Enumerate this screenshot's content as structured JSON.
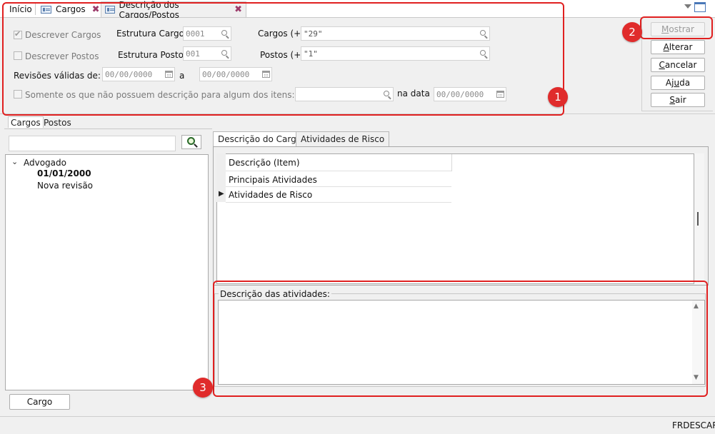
{
  "tabs": [
    {
      "label": "Início",
      "closable": false
    },
    {
      "label": "Cargos",
      "closable": true,
      "icon": "form-icon"
    },
    {
      "label": "Descrição dos Cargos/Postos",
      "closable": true,
      "icon": "form-icon",
      "active": true
    }
  ],
  "filters": {
    "descrever_cargos": {
      "label": "Descrever Cargos",
      "checked": true,
      "enabled": false
    },
    "descrever_postos": {
      "label": "Descrever Postos",
      "checked": false,
      "enabled": false
    },
    "estrutura_cargos": {
      "label": "Estrutura Cargos:",
      "value": "0001"
    },
    "estrutura_postos": {
      "label": "Estrutura Postos:",
      "value": "001"
    },
    "cargos": {
      "label": "Cargos (+):",
      "value": "\"29\""
    },
    "postos": {
      "label": "Postos (+):",
      "value": "\"1\""
    },
    "revisoes": {
      "label": "Revisões válidas de:",
      "from": "00/00/0000",
      "sep": "a",
      "to": "00/00/0000"
    },
    "somente": {
      "label": "Somente os que não possuem descrição para algum dos itens:",
      "checked": false
    },
    "na_data": {
      "label": "na data",
      "value": "00/00/0000"
    }
  },
  "buttons": {
    "mostrar": {
      "pre": "",
      "key": "M",
      "rest": "ostrar",
      "enabled": false
    },
    "alterar": {
      "pre": "",
      "key": "A",
      "rest": "lterar"
    },
    "cancelar": {
      "pre": "",
      "key": "C",
      "rest": "ancelar"
    },
    "ajuda": {
      "pre": "Aj",
      "key": "u",
      "rest": "da"
    },
    "sair": {
      "pre": "",
      "key": "S",
      "rest": "air"
    }
  },
  "annotations": {
    "one": "1",
    "two": "2",
    "three": "3",
    "color": "#e02020"
  },
  "left_panel": {
    "tabs": [
      "Cargos",
      "Postos"
    ],
    "search_value": "",
    "tree": {
      "root": "Advogado",
      "date": "01/01/2000",
      "revision": "Nova revisão"
    },
    "cargo_button": "Cargo"
  },
  "right_panel": {
    "tabs": [
      "Descrição do Cargo",
      "Atividades de Risco"
    ],
    "grid_header": "Descrição (Item)",
    "rows": [
      "Principais Atividades",
      "Atividades de Risco"
    ],
    "selected_row": 1,
    "description_label": "Descrição das atividades:"
  },
  "status": {
    "text": "FRDESCAR"
  }
}
